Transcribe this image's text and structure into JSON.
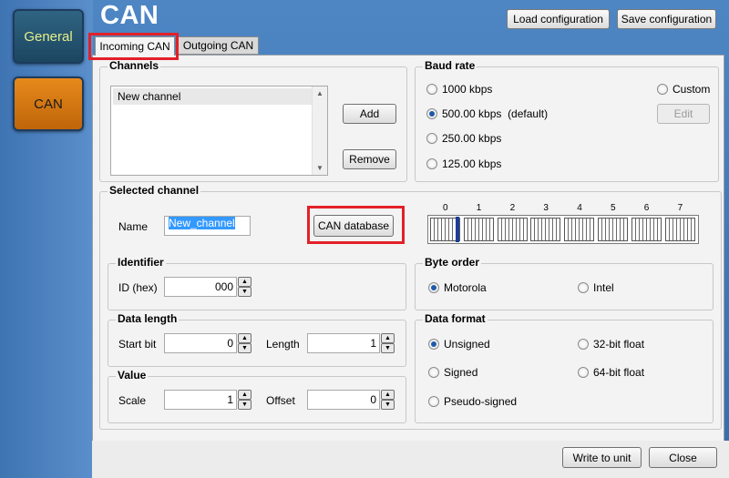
{
  "sidebar": {
    "general_label": "General",
    "can_label": "CAN"
  },
  "header": {
    "title": "CAN",
    "load_label": "Load configuration",
    "save_label": "Save configuration"
  },
  "tabs": [
    {
      "label": "Incoming CAN"
    },
    {
      "label": "Outgoing CAN"
    }
  ],
  "channels": {
    "title": "Channels",
    "items": [
      "New channel"
    ],
    "add_label": "Add",
    "remove_label": "Remove"
  },
  "baud": {
    "title": "Baud rate",
    "options": [
      "1000 kbps",
      "500.00 kbps",
      "250.00 kbps",
      "125.00 kbps"
    ],
    "default_note": "(default)",
    "selected": "500.00 kbps",
    "custom_label": "Custom",
    "edit_label": "Edit"
  },
  "selected_channel": {
    "title": "Selected channel",
    "name_label": "Name",
    "name_value": "New_channel",
    "candb_label": "CAN database",
    "byte_numbers": [
      "0",
      "1",
      "2",
      "3",
      "4",
      "5",
      "6",
      "7"
    ]
  },
  "identifier": {
    "title": "Identifier",
    "id_label": "ID (hex)",
    "id_value": "000"
  },
  "byte_order": {
    "title": "Byte order",
    "motorola": "Motorola",
    "intel": "Intel",
    "selected": "Motorola"
  },
  "data_length": {
    "title": "Data length",
    "start_label": "Start bit",
    "start_value": "0",
    "length_label": "Length",
    "length_value": "1"
  },
  "data_format": {
    "title": "Data format",
    "unsigned": "Unsigned",
    "signed": "Signed",
    "pseudo": "Pseudo-signed",
    "f32": "32-bit float",
    "f64": "64-bit float",
    "selected": "Unsigned"
  },
  "value": {
    "title": "Value",
    "scale_label": "Scale",
    "scale_value": "1",
    "offset_label": "Offset",
    "offset_value": "0"
  },
  "footer": {
    "write_label": "Write to unit",
    "close_label": "Close"
  },
  "colors": {
    "accent": "#1f5aa8",
    "highlight": "#e32028",
    "can_button": "#e68a1c"
  }
}
